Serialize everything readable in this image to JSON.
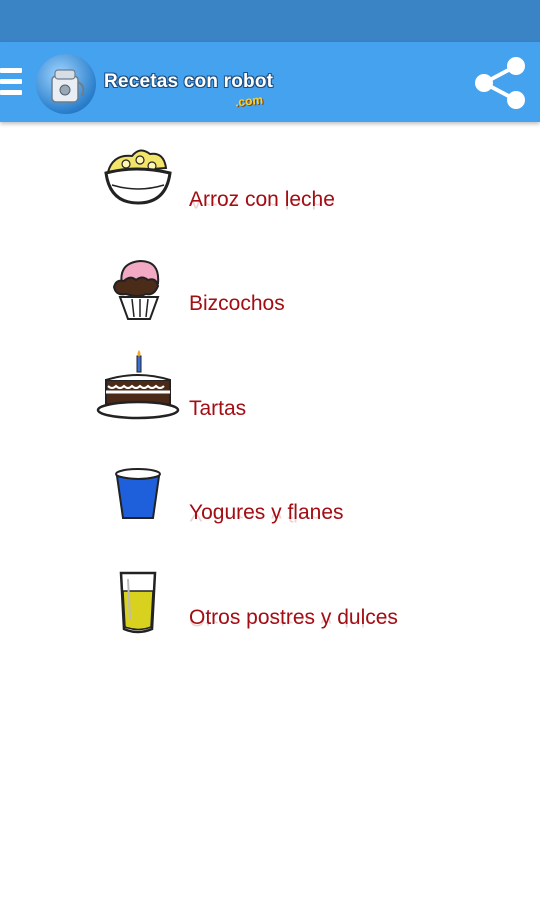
{
  "app": {
    "title_main": "Recetas con robot",
    "title_suffix": ".com",
    "menu_icon": "hamburger-menu-icon",
    "share_icon": "share-icon"
  },
  "colors": {
    "status_bar": "#3a84c6",
    "app_bar": "#45a2ee",
    "item_text": "#a30d14"
  },
  "categories": [
    {
      "label": "Arroz con leche",
      "icon": "rice-bowl-icon"
    },
    {
      "label": "Bizcochos",
      "icon": "cupcake-icon"
    },
    {
      "label": "Tartas",
      "icon": "cake-icon"
    },
    {
      "label": "Yogures y flanes",
      "icon": "yogurt-cup-icon"
    },
    {
      "label": "Otros postres y dulces",
      "icon": "glass-dessert-icon"
    }
  ]
}
